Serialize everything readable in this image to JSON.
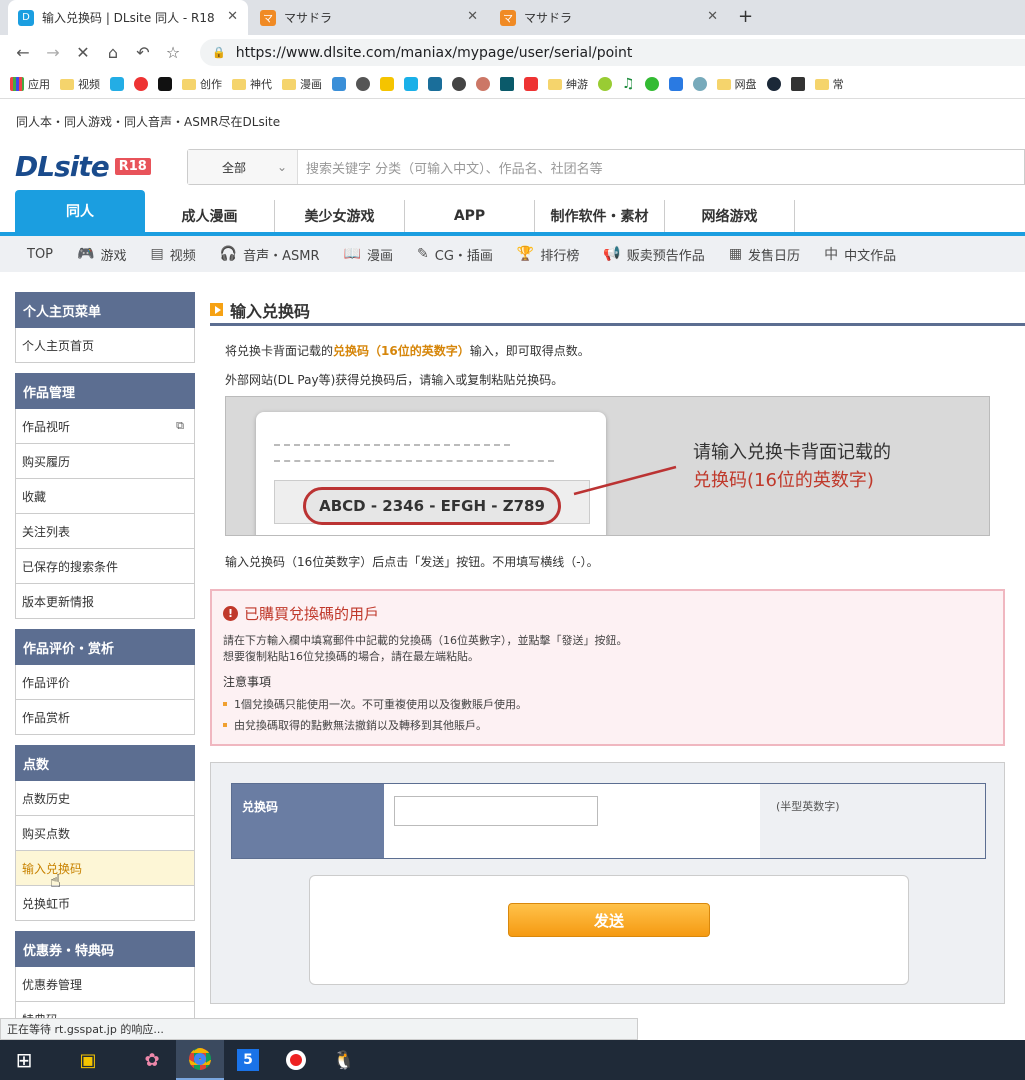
{
  "browser": {
    "tabs": [
      {
        "title": "输入兑换码 | DLsite 同人 - R18",
        "favicon_color": "#1b9ee0"
      },
      {
        "title": "マサドラ",
        "favicon_color": "#f08a24"
      },
      {
        "title": "マサドラ",
        "favicon_color": "#f08a24"
      }
    ],
    "new_tab": "+",
    "url": "https://www.dlsite.com/maniax/mypage/user/serial/point",
    "bookmarks": [
      "应用",
      "视频",
      "创作",
      "神代",
      "漫画",
      "绅游",
      "网盘",
      "常"
    ]
  },
  "header": {
    "tagline": "同人本・同人游戏・同人音声・ASMR尽在DLsite",
    "logo_text": "DLsite",
    "logo_badge": "R18",
    "search_category": "全部",
    "search_placeholder": "搜索关键字 分类（可输入中文）、作品名、社团名等"
  },
  "main_nav": [
    "同人",
    "成人漫画",
    "美少女游戏",
    "APP",
    "制作软件・素材",
    "网络游戏"
  ],
  "sub_nav": [
    {
      "label": "TOP",
      "icon": ""
    },
    {
      "label": "游戏",
      "icon": "🎮"
    },
    {
      "label": "视频",
      "icon": "▤"
    },
    {
      "label": "音声・ASMR",
      "icon": "🎧"
    },
    {
      "label": "漫画",
      "icon": "📖"
    },
    {
      "label": "CG・插画",
      "icon": "✎"
    },
    {
      "label": "排行榜",
      "icon": "🏆"
    },
    {
      "label": "贩卖预告作品",
      "icon": "📢"
    },
    {
      "label": "发售日历",
      "icon": "▦"
    },
    {
      "label": "中文作品",
      "icon": "中"
    }
  ],
  "sidebar": {
    "groups": [
      {
        "title": "个人主页菜单",
        "items": [
          "个人主页首页"
        ]
      },
      {
        "title": "作品管理",
        "items": [
          "作品视听",
          "购买履历",
          "收藏",
          "关注列表",
          "已保存的搜索条件",
          "版本更新情报"
        ]
      },
      {
        "title": "作品评价・赏析",
        "items": [
          "作品评价",
          "作品赏析"
        ]
      },
      {
        "title": "点数",
        "items": [
          "点数历史",
          "购买点数",
          "输入兑换码",
          "兑换虹币"
        ]
      },
      {
        "title": "优惠券・特典码",
        "items": [
          "优惠券管理",
          "特典码"
        ]
      }
    ]
  },
  "page": {
    "title": "输入兑换码",
    "intro_before": "将兑换卡背面记载的",
    "intro_highlight": "兑换码（16位的英数字）",
    "intro_after": "输入，即可取得点数。",
    "intro2": "外部网站(DL Pay等)获得兑换码后，请输入或复制粘贴兑换码。",
    "sample_code": "ABCD - 2346 - EFGH - Z789",
    "illus_line1": "请输入兑换卡背面记载的",
    "illus_line2": "兑换码(16位的英数字)",
    "instruction": "输入兑换码（16位英数字）后点击「发送」按钮。不用填写横线（-）。"
  },
  "warning": {
    "title": "已購買兌換碼的用戶",
    "line1": "請在下方輸入欄中填寫郵件中記載的兌換碼（16位英數字），並點擊「發送」按鈕。",
    "line2": "想要復制粘貼16位兌換碼的場合，請在最左端粘貼。",
    "subtitle": "注意事項",
    "bullets": [
      "1個兌換碼只能使用一次。不可重複使用以及復數賬戶使用。",
      "由兌換碼取得的點數無法撤銷以及轉移到其他賬戶。"
    ]
  },
  "form": {
    "label": "兑换码",
    "note": "(半型英数字)",
    "submit": "发送"
  },
  "status_text": "正在等待 rt.gsspat.jp 的响应...",
  "colors": {
    "accent": "#1b9ee0",
    "sidebar_head": "#5c6e91",
    "highlight": "#d6860a",
    "alert": "#c0392b"
  }
}
